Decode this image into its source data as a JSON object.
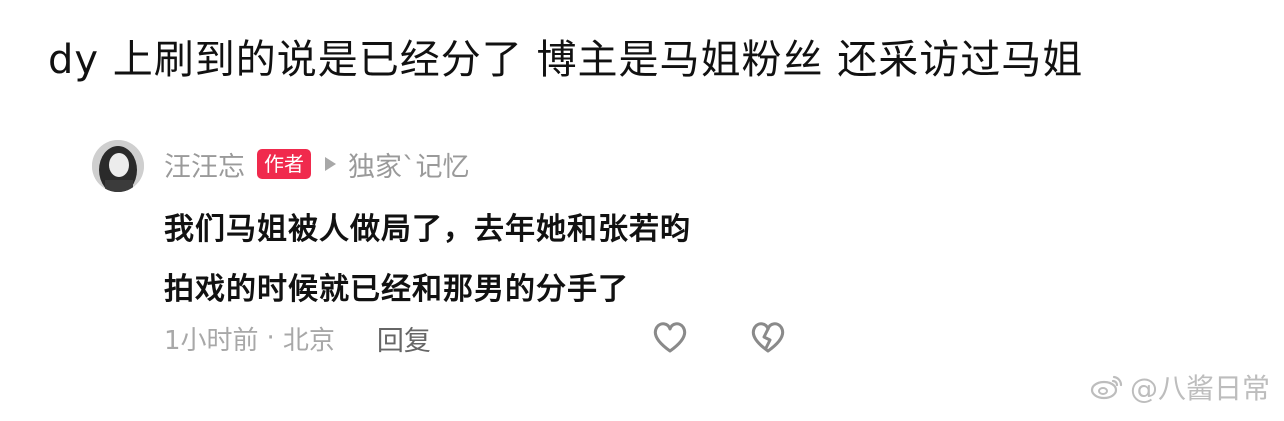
{
  "caption": {
    "text": "dy 上刷到的说是已经分了 博主是马姐粉丝 还采访过马姐"
  },
  "comment": {
    "author": "汪汪忘",
    "badge": "作者",
    "reply_arrow_icon": "play-triangle-icon",
    "reply_to": "独家`记忆",
    "body_lines": [
      "我们马姐被人做局了，去年她和张若昀",
      "拍戏的时候就已经和那男的分手了"
    ],
    "time": "1小时前",
    "separator": "·",
    "location": "北京",
    "reply_label": "回复",
    "like_icon": "heart-outline-icon",
    "dislike_icon": "broken-heart-icon"
  },
  "watermark": {
    "icon": "weibo-logo-icon",
    "text": "@八酱日常"
  },
  "colors": {
    "badge_bg": "#f02a4d",
    "muted_text": "#9a9a9a",
    "body_text": "#111111"
  }
}
